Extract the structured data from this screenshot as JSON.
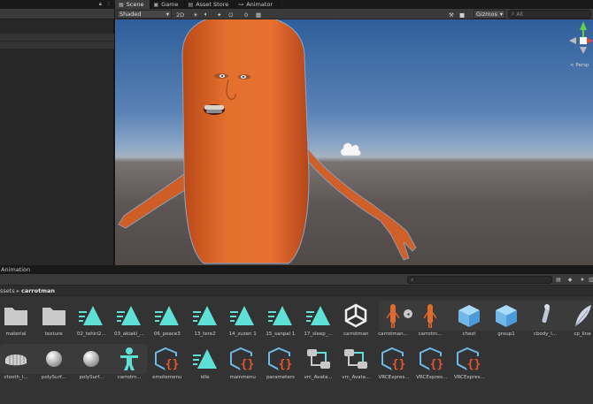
{
  "tabs": [
    {
      "label": "Scene",
      "icon": "grid-icon",
      "active": true
    },
    {
      "label": "Game",
      "icon": "gamepad-icon",
      "active": false
    },
    {
      "label": "Asset Store",
      "icon": "store-icon",
      "active": false
    },
    {
      "label": "Animator",
      "icon": "animator-icon",
      "active": false
    }
  ],
  "scene_toolbar": {
    "shading_mode": "Shaded",
    "mode_2d": "2D",
    "hidden_count": "0",
    "gizmos_label": "Gizmos",
    "search_placeholder": "All"
  },
  "viewport": {
    "projection_label": "< Persp"
  },
  "animation_panel": {
    "label": "Animation"
  },
  "project": {
    "breadcrumb": [
      "Assets",
      "carrotman"
    ],
    "breadcrumb_visible_root": "ssets"
  },
  "assets_row1": [
    {
      "label": "material",
      "icon": "folder-icon"
    },
    {
      "label": "texture",
      "icon": "folder-icon"
    },
    {
      "label": "02_tehiri2...",
      "icon": "animation-clip-icon"
    },
    {
      "label": "03_akiaki_...",
      "icon": "animation-clip-icon"
    },
    {
      "label": "06_peace3",
      "icon": "animation-clip-icon"
    },
    {
      "label": "13_tere2",
      "icon": "animation-clip-icon"
    },
    {
      "label": "14_zuzen 1",
      "icon": "animation-clip-icon"
    },
    {
      "label": "15_sanpai 1",
      "icon": "animation-clip-icon"
    },
    {
      "label": "17_sleep_...",
      "icon": "animation-clip-icon"
    },
    {
      "label": "carrotman",
      "icon": "unity-logo-icon"
    },
    {
      "label": "carrotman...",
      "icon": "carrot-model-icon"
    },
    {
      "label": "carrotm...",
      "icon": "carrot-model-icon"
    },
    {
      "label": "chest",
      "icon": "prefab-icon"
    },
    {
      "label": "group1",
      "icon": "prefab-icon"
    },
    {
      "label": "cbody_l...",
      "icon": "bone-icon"
    },
    {
      "label": "cp_line",
      "icon": "feather-icon"
    }
  ],
  "assets_row2": [
    {
      "label": "ctooth_l...",
      "icon": "teeth-mesh-icon"
    },
    {
      "label": "polySurf...",
      "icon": "sphere-icon"
    },
    {
      "label": "polySurf...",
      "icon": "sphere-icon"
    },
    {
      "label": "carrotm...",
      "icon": "avatar-icon"
    },
    {
      "label": "emotemenu",
      "icon": "script-object-icon"
    },
    {
      "label": "idle",
      "icon": "animation-clip-icon"
    },
    {
      "label": "mainmenu",
      "icon": "script-object-icon"
    },
    {
      "label": "parameters",
      "icon": "script-object-icon"
    },
    {
      "label": "vrc_Avata...",
      "icon": "animator-controller-icon"
    },
    {
      "label": "vrc_Avata...",
      "icon": "animator-controller-icon"
    },
    {
      "label": "VRCExpres...",
      "icon": "script-object-icon"
    },
    {
      "label": "VRCExpres...",
      "icon": "script-object-icon"
    },
    {
      "label": "VRCExpres...",
      "icon": "script-object-icon"
    }
  ],
  "colors": {
    "accent_teal": "#5fe0d6",
    "prefab_blue": "#6fb8e8",
    "carrot_orange": "#e06a2e",
    "panel_bg": "#333333"
  }
}
